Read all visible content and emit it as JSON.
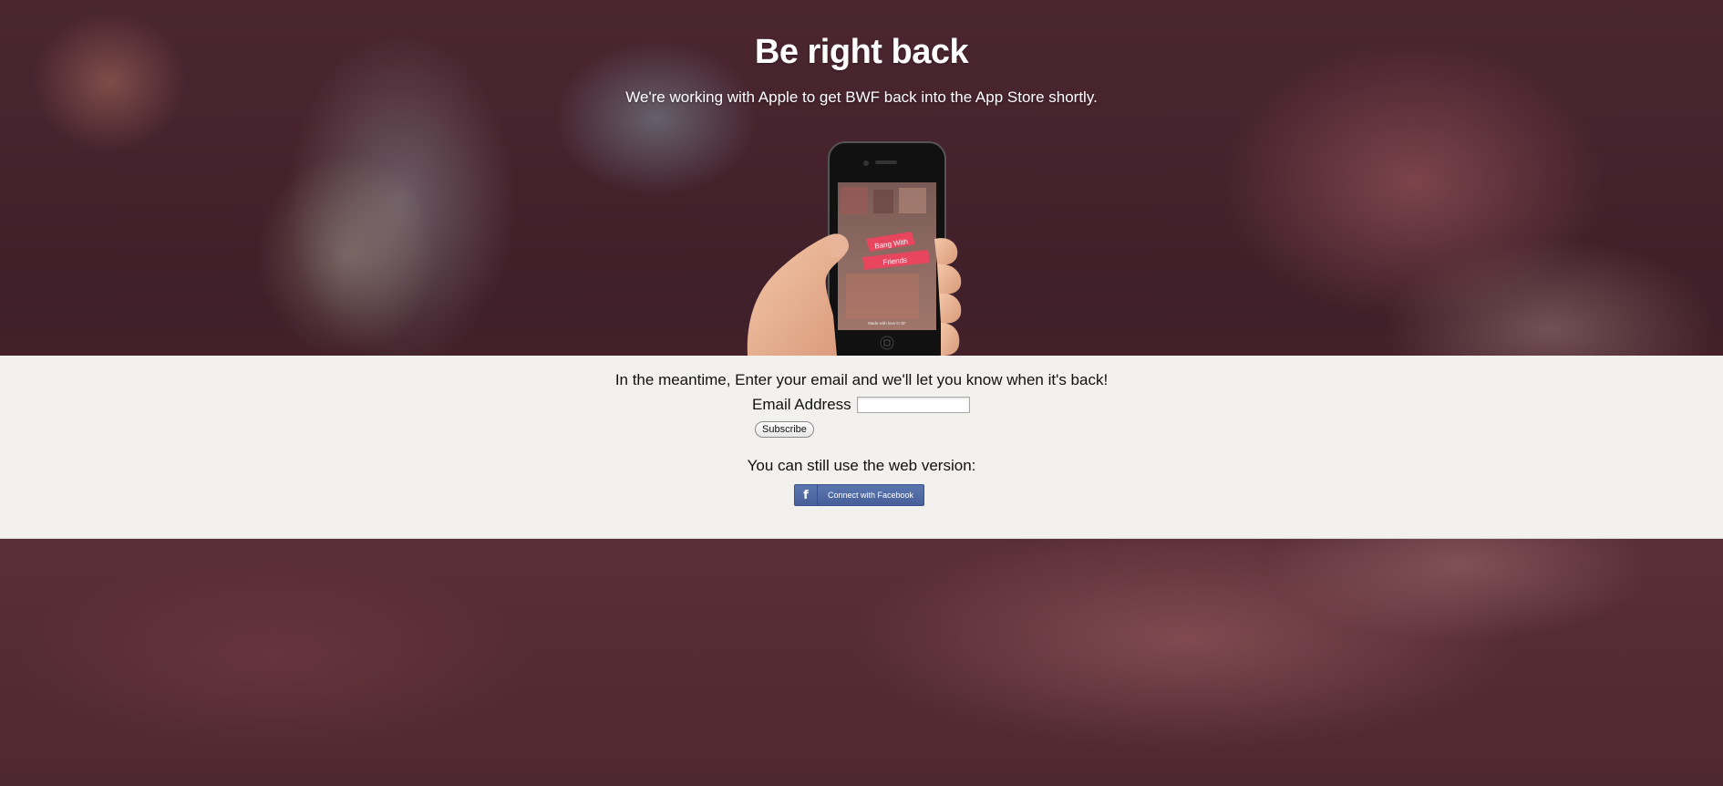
{
  "hero": {
    "title": "Be right back",
    "subtitle": "We're working with Apple to get BWF back into the App Store shortly."
  },
  "phone": {
    "banner_line1": "Bang With",
    "banner_line2": "Friends",
    "footer_text": "Made with love in SF",
    "banner_color": "#e8455f"
  },
  "signup": {
    "prompt": "In the meantime, Enter your email and we'll let you know when it's back!",
    "email_label": "Email Address",
    "email_value": "",
    "subscribe_label": "Subscribe"
  },
  "web": {
    "prompt": "You can still use the web version:",
    "facebook_label": "Connect with Facebook",
    "facebook_color": "#4a64a0"
  }
}
